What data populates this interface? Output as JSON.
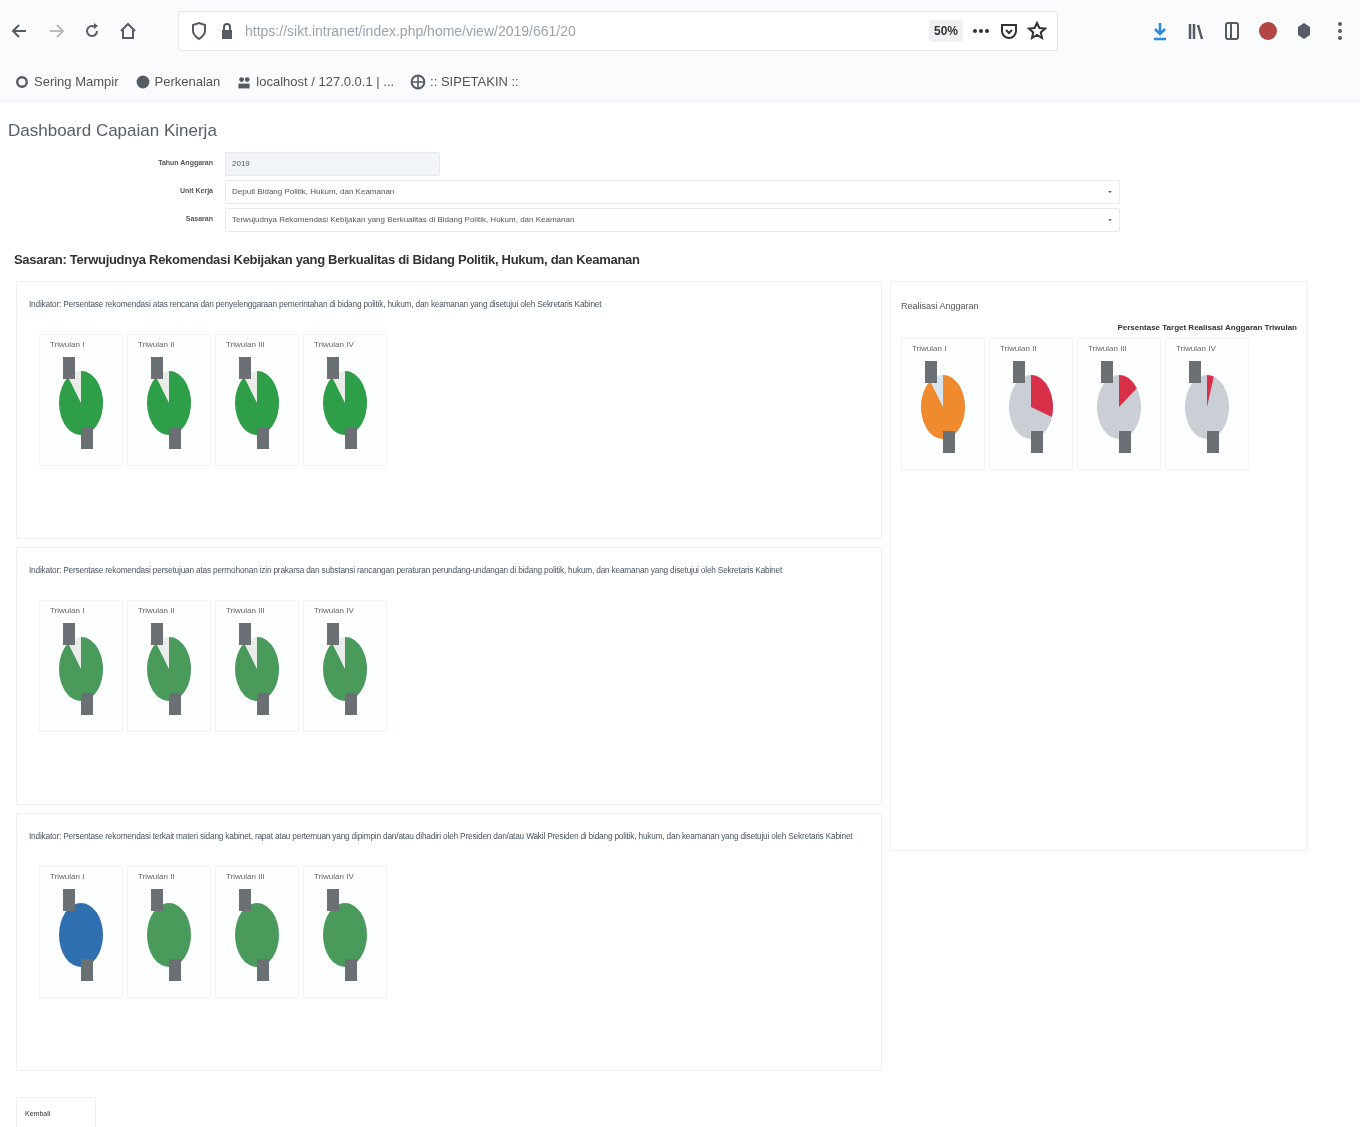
{
  "browser": {
    "url": "https://sikt.intranet/index.php/home/view/2019/661/20",
    "zoom": "50%",
    "bookmarks": [
      {
        "label": "Sering Mampir"
      },
      {
        "label": "Perkenalan"
      },
      {
        "label": "localhost / 127.0.0.1 | ..."
      },
      {
        "label": ":: SIPETAKIN ::"
      }
    ]
  },
  "page": {
    "title": "Dashboard Capaian Kinerja",
    "filters": [
      {
        "label": "Tahun Anggaran",
        "value": "2019",
        "kind": "text"
      },
      {
        "label": "Unit Kerja",
        "value": "Deputi Bidang Politik, Hukum, dan Keamanan",
        "kind": "select"
      },
      {
        "label": "Sasaran",
        "value": "Terwujudnya Rekomendasi Kebijakan yang Berkualitas di Bidang Politik, Hukum, dan Keamanan",
        "kind": "select"
      }
    ],
    "heading": "Sasaran: Terwujudnya Rekomendasi Kebijakan yang Berkualitas di Bidang Politik, Hukum, dan Keamanan",
    "indicators": [
      {
        "text": "Indikator: Persentase rekomendasi atas rencana dan penyelenggaraan pemerintahan di bidang politik, hukum, dan keamanan yang disetujui oleh Sekretaris Kabinet",
        "pies": [
          {
            "label": "Triwulan I",
            "kind": "large",
            "slices": [
              {
                "color": "#2e9e48"
              },
              {
                "color": "#e9ece9"
              }
            ]
          },
          {
            "label": "Triwulan II",
            "kind": "large",
            "slices": [
              {
                "color": "#2e9e48"
              },
              {
                "color": "#e9ece9"
              }
            ]
          },
          {
            "label": "Triwulan III",
            "kind": "large",
            "slices": [
              {
                "color": "#2e9e48"
              },
              {
                "color": "#e9ece9"
              }
            ]
          },
          {
            "label": "Triwulan IV",
            "kind": "large",
            "slices": [
              {
                "color": "#2e9e48"
              },
              {
                "color": "#e9ece9"
              }
            ]
          }
        ]
      },
      {
        "text": "Indikator: Persentase rekomendasi persetujuan atas permohonan izin prakarsa dan substansi rancangan peraturan perundang-undangan di bidang politik, hukum, dan keamanan yang disetujui oleh Sekretaris Kabinet",
        "pies": [
          {
            "label": "Triwulan I",
            "kind": "large",
            "slices": [
              {
                "color": "#4a9a5c"
              },
              {
                "color": "#e9ece9"
              }
            ]
          },
          {
            "label": "Triwulan II",
            "kind": "large",
            "slices": [
              {
                "color": "#4a9a5c"
              },
              {
                "color": "#e9ece9"
              }
            ]
          },
          {
            "label": "Triwulan III",
            "kind": "large",
            "slices": [
              {
                "color": "#4a9a5c"
              },
              {
                "color": "#e9ece9"
              }
            ]
          },
          {
            "label": "Triwulan IV",
            "kind": "large",
            "slices": [
              {
                "color": "#4a9a5c"
              },
              {
                "color": "#e9ece9"
              }
            ]
          }
        ]
      },
      {
        "text": "Indikator: Persentase rekomendasi terkait materi sidang kabinet, rapat atau pertemuan yang dipimpin dan/atau dihadiri oleh Presiden dan/atau Wakil Presiden di bidang politik, hukum, dan keamanan yang disetujui oleh Sekretaris Kabinet",
        "pies": [
          {
            "label": "Triwulan I",
            "kind": "full",
            "slices": [
              {
                "color": "#2f6fb0"
              }
            ]
          },
          {
            "label": "Triwulan II",
            "kind": "full",
            "slices": [
              {
                "color": "#4a9a5c"
              }
            ]
          },
          {
            "label": "Triwulan III",
            "kind": "full",
            "slices": [
              {
                "color": "#4a9a5c"
              }
            ]
          },
          {
            "label": "Triwulan IV",
            "kind": "full",
            "slices": [
              {
                "color": "#4a9a5c"
              }
            ]
          }
        ]
      }
    ],
    "budget": {
      "title": "Realisasi Anggaran",
      "note": "Persentase Target Realisasi Anggaran Triwulan",
      "pies": [
        {
          "label": "Triwulan I",
          "kind": "large",
          "slices": [
            {
              "color": "#ef8a2e"
            },
            {
              "color": "#d6e4ee"
            }
          ]
        },
        {
          "label": "Triwulan II",
          "kind": "third",
          "slices": [
            {
              "color": "#d9304a"
            },
            {
              "color": "#c9cfd4"
            }
          ]
        },
        {
          "label": "Triwulan III",
          "kind": "small",
          "slices": [
            {
              "color": "#d9304a"
            },
            {
              "color": "#c9cfd4"
            }
          ]
        },
        {
          "label": "Triwulan IV",
          "kind": "sliver",
          "slices": [
            {
              "color": "#d9304a"
            },
            {
              "color": "#c9cfd4"
            }
          ]
        }
      ]
    },
    "footer_tab": "Kembali"
  }
}
